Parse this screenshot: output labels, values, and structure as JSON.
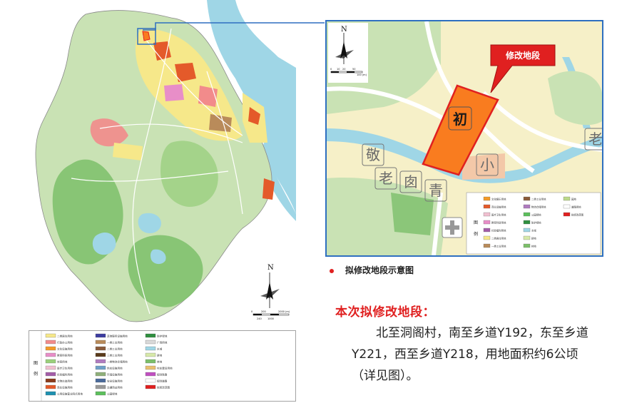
{
  "inset": {
    "callout_label": "修改地段",
    "parcel_char": "初",
    "place_chars": [
      "敬",
      "老",
      "囱",
      "青",
      "小",
      "老"
    ],
    "legend_title": "图例",
    "legend_items": [
      {
        "label": "文化娱乐用地",
        "color": "#f39a28"
      },
      {
        "label": "商业设施用地",
        "color": "#e45a2a"
      },
      {
        "label": "医疗卫生用地",
        "color": "#f0c0d0"
      },
      {
        "label": "教育科研用地",
        "color": "#e88ec8"
      },
      {
        "label": "社会福利用地",
        "color": "#a35da8"
      },
      {
        "label": "二类居住用地",
        "color": "#f6e88a"
      },
      {
        "label": "一类工业用地",
        "color": "#b98b5a"
      },
      {
        "label": "二类工业用地",
        "color": "#8a5a3a"
      },
      {
        "label": "物流仓储用地",
        "color": "#b07cc0"
      },
      {
        "label": "公园绿地",
        "color": "#5cbf5c"
      },
      {
        "label": "防护绿地",
        "color": "#2f8f3f"
      },
      {
        "label": "水域",
        "color": "#9fd6e6"
      },
      {
        "label": "耕地",
        "color": "#d7e9a9"
      },
      {
        "label": "林地",
        "color": "#7cbf6a"
      },
      {
        "label": "园地",
        "color": "#bcd98a"
      },
      {
        "label": "道路用地",
        "color": "#ffffff"
      },
      {
        "label": "拟修改范围",
        "color": "#e02020"
      }
    ]
  },
  "caption": "拟修改地段示意图",
  "heading": "本次拟修改地段：",
  "body": "北至洞阁村，南至乡道Y192，东至乡道Y221，西至乡道Y218，用地面积约6公顷（详见图）。",
  "big_legend": {
    "title": "图例",
    "items": [
      {
        "label": "二类居住用地",
        "color": "#f6e88a"
      },
      {
        "label": "行政办公用地",
        "color": "#f28b8b"
      },
      {
        "label": "文化设施用地",
        "color": "#f39a28"
      },
      {
        "label": "教育科研用地",
        "color": "#e88ec8"
      },
      {
        "label": "体育用地",
        "color": "#9bd07b"
      },
      {
        "label": "医疗卫生用地",
        "color": "#f0c0d0"
      },
      {
        "label": "社会福利用地",
        "color": "#a35da8"
      },
      {
        "label": "文物古迹用地",
        "color": "#8a3b1b"
      },
      {
        "label": "商业设施用地",
        "color": "#e45a2a"
      },
      {
        "label": "公用设施营业网点用地",
        "color": "#1e90b0"
      },
      {
        "label": "其他服务设施用地",
        "color": "#3c3ca0"
      },
      {
        "label": "一类工业用地",
        "color": "#b98b5a"
      },
      {
        "label": "二类工业用地",
        "color": "#8a5a3a"
      },
      {
        "label": "三类工业用地",
        "color": "#5a3a1a"
      },
      {
        "label": "一类物流仓储用地",
        "color": "#b07cc0"
      },
      {
        "label": "供应设施用地",
        "color": "#6fa0c8"
      },
      {
        "label": "环境设施用地",
        "color": "#8fb07a"
      },
      {
        "label": "安全设施用地",
        "color": "#4a6a9a"
      },
      {
        "label": "交通场站用地",
        "color": "#9a9a9a"
      },
      {
        "label": "公园绿地",
        "color": "#5cbf5c"
      },
      {
        "label": "防护绿地",
        "color": "#2f8f3f"
      },
      {
        "label": "广场用地",
        "color": "#d9d9d9"
      },
      {
        "label": "水域",
        "color": "#9fd6e6"
      },
      {
        "label": "耕地",
        "color": "#d7e9a9"
      },
      {
        "label": "林地",
        "color": "#7cbf6a"
      },
      {
        "label": "村庄建设用地",
        "color": "#e8c070"
      },
      {
        "label": "规划铁路",
        "color": "#c050c0"
      },
      {
        "label": "规划道路",
        "color": "#ffffff"
      },
      {
        "label": "拟修改范围",
        "color": "#e02020"
      }
    ]
  },
  "north_label": "N",
  "big_scale": {
    "labels": [
      "0",
      "200",
      "2000 (m)",
      "240",
      "1000"
    ]
  },
  "inset_scale": {
    "labels": [
      "0",
      "10",
      "20",
      "50",
      "100 (m)"
    ]
  }
}
